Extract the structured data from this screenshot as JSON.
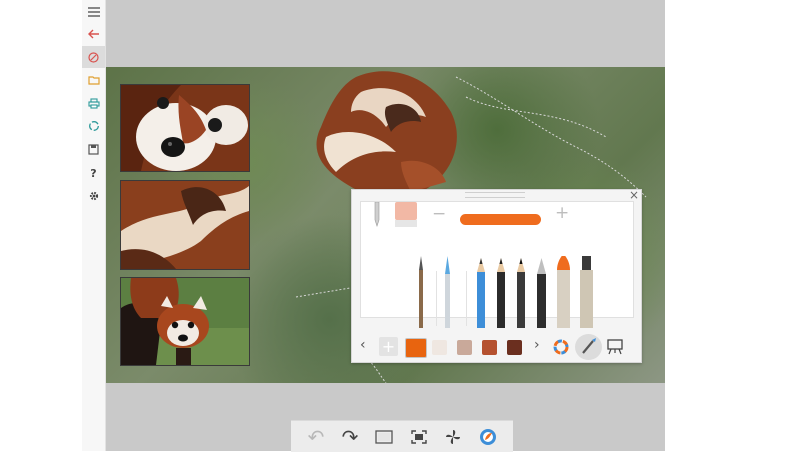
{
  "sidebar": {
    "items": [
      {
        "name": "menu-icon",
        "glyph": "☰"
      },
      {
        "name": "back-arrow-icon",
        "glyph": "←"
      },
      {
        "name": "compass-icon",
        "glyph": "⊘"
      },
      {
        "name": "folder-icon",
        "glyph": "▭"
      },
      {
        "name": "printer-icon",
        "glyph": "⎙"
      },
      {
        "name": "recycle-icon",
        "glyph": "♻"
      },
      {
        "name": "save-icon",
        "glyph": "▣"
      },
      {
        "name": "help-icon",
        "glyph": "?"
      },
      {
        "name": "settings-gear-icon",
        "glyph": "⚙"
      }
    ],
    "active_index": 2
  },
  "panel": {
    "close_glyph": "×",
    "minus_glyph": "−",
    "plus_glyph": "+",
    "size_level_fraction": 1.0,
    "size_color": "#ef6c1e",
    "prev_glyph": "‹",
    "next_glyph": "›",
    "add_glyph": "+",
    "swatches": [
      "#e8640f",
      "#efe7e1",
      "#c9a99a",
      "#b5512f",
      "#6b2f1f"
    ],
    "selected_swatch": 0
  },
  "toolbar": {
    "undo_glyph": "↶",
    "redo_glyph": "↷"
  },
  "colors": {
    "accent": "#ef6c1e",
    "workspace": "#c9c9c9",
    "sidebar_icon_red": "#d9534f",
    "sidebar_icon_teal": "#2d9a9a"
  }
}
